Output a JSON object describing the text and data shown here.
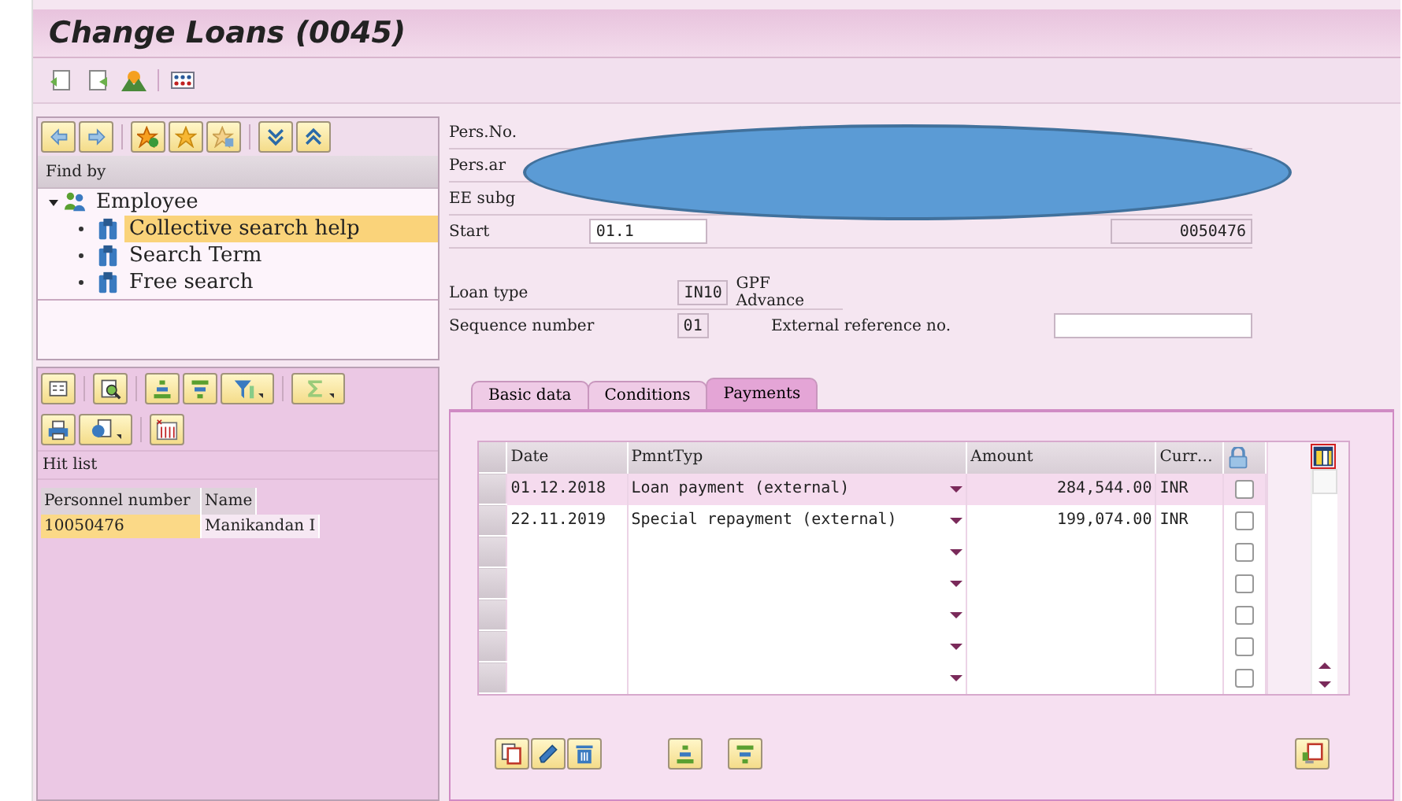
{
  "window": {
    "title": "Change Loans (0045)"
  },
  "navigation": {
    "find_by_label": "Find by",
    "tree": [
      {
        "label": "Employee",
        "expanded": true,
        "children": [
          {
            "label": "Collective search help",
            "selected": true
          },
          {
            "label": "Search Term",
            "selected": false
          },
          {
            "label": "Free search",
            "selected": false
          }
        ]
      }
    ]
  },
  "hit_list": {
    "title": "Hit list",
    "columns": [
      "Personnel number",
      "Name"
    ],
    "rows": [
      {
        "cells": [
          "10050476",
          "Manikandan I"
        ],
        "selected": true
      }
    ]
  },
  "header_fields": [
    {
      "label": "Pers.No."
    },
    {
      "label": "Pers.ar"
    },
    {
      "label": "EE subg"
    },
    {
      "label": "Start",
      "value": "01.1",
      "value_2": "0050476"
    }
  ],
  "loan": {
    "loan_type_label": "Loan type",
    "loan_type_code": "IN10",
    "loan_type_text": "GPF Advance",
    "sequence_label": "Sequence number",
    "sequence_value": "01",
    "external_reference_label": "External reference no."
  },
  "tabs": [
    {
      "label": "Basic data",
      "selected": false
    },
    {
      "label": "Conditions",
      "selected": false
    },
    {
      "label": "Payments",
      "selected": true
    }
  ],
  "payments": {
    "columns": [
      "Date",
      "PmntTyp",
      "Amount",
      "Curr…"
    ],
    "rows": [
      {
        "date": "01.12.2018",
        "type": "Loan payment (external)",
        "amount": "284,544.00",
        "currency": "INR",
        "checked": false,
        "selected": true
      },
      {
        "date": "22.11.2019",
        "type": "Special repayment (external)",
        "amount": "199,074.00",
        "currency": "INR",
        "checked": false,
        "selected": false
      },
      {
        "checked": false,
        "selected": false
      },
      {
        "checked": false,
        "selected": false
      },
      {
        "checked": false,
        "selected": false
      },
      {
        "checked": false,
        "selected": false
      },
      {
        "checked": false,
        "selected": false
      }
    ]
  }
}
